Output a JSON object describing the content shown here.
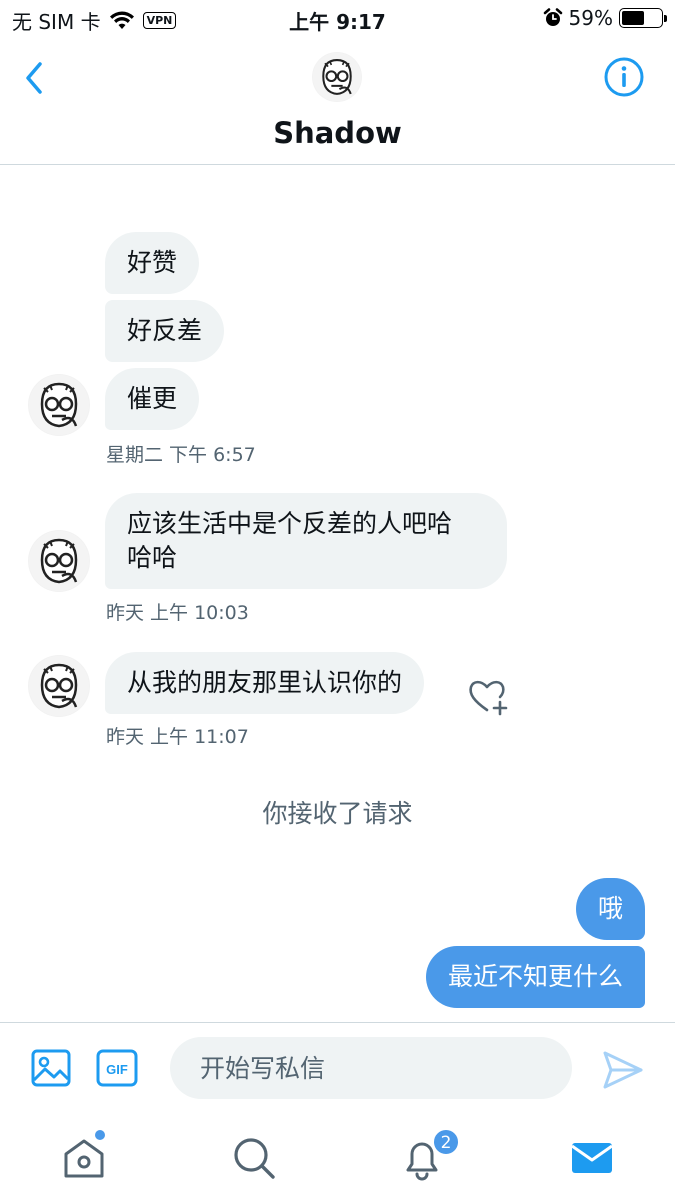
{
  "status_bar": {
    "carrier": "无 SIM 卡",
    "vpn": "VPN",
    "time": "上午 9:17",
    "battery_percent": "59%",
    "battery_level": 0.59
  },
  "header": {
    "contact_name": "Shadow"
  },
  "messages": {
    "group1": [
      "好赞",
      "好反差",
      "催更"
    ],
    "group1_time": "星期二 下午 6:57",
    "group2_line1": "应该生活中是个反差的人吧哈",
    "group2_line2": "哈哈",
    "group2_time": "昨天 上午 10:03",
    "group3": "从我的朋友那里认识你的",
    "group3_time": "昨天 上午 11:07",
    "system_note": "你接收了请求",
    "outgoing": [
      "哦",
      "最近不知更什么"
    ]
  },
  "compose": {
    "placeholder": "开始写私信",
    "gif_label": "GIF"
  },
  "tabbar": {
    "notification_count": "2"
  },
  "colors": {
    "accent": "#4a99e9",
    "incoming_bubble": "#eff3f4",
    "secondary_text": "#536471"
  }
}
